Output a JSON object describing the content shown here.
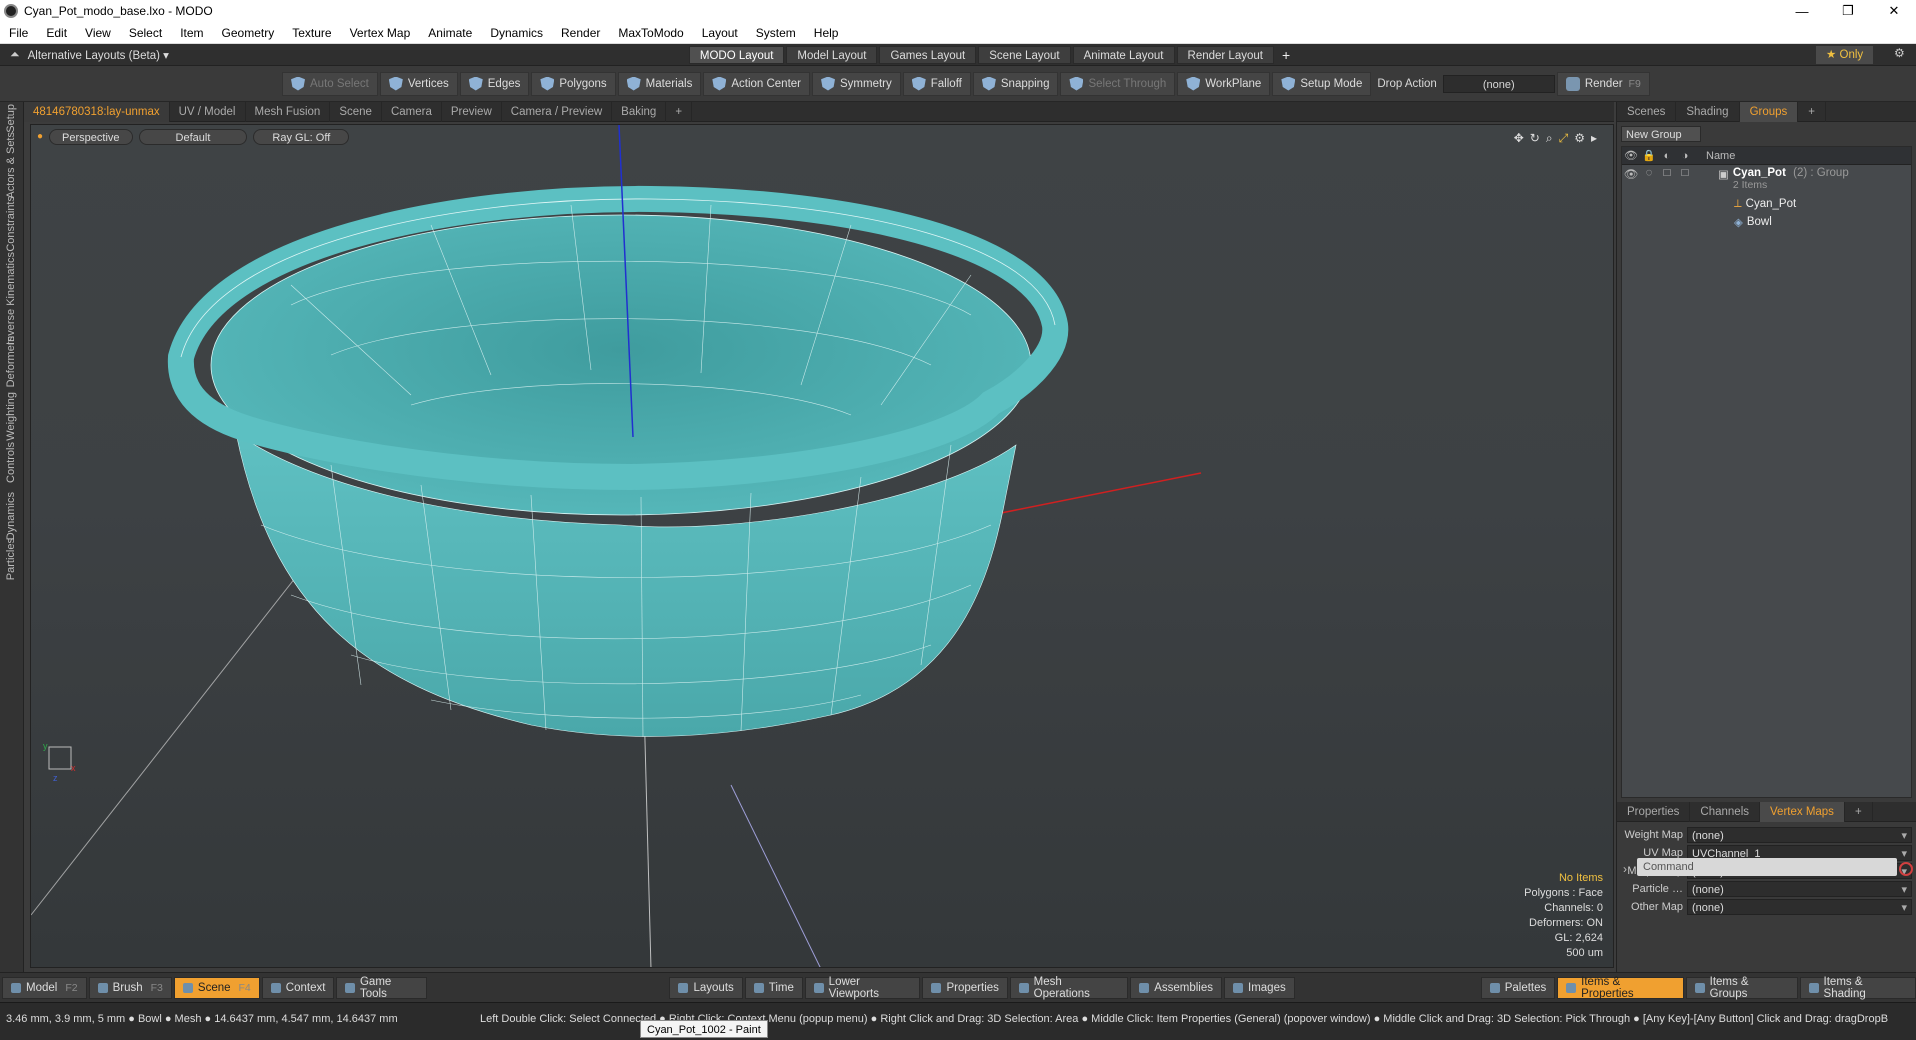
{
  "window": {
    "title": "Cyan_Pot_modo_base.lxo - MODO",
    "controls": [
      "—",
      "❐",
      "✕"
    ]
  },
  "menu": [
    "File",
    "Edit",
    "View",
    "Select",
    "Item",
    "Geometry",
    "Texture",
    "Vertex Map",
    "Animate",
    "Dynamics",
    "Render",
    "MaxToModo",
    "Layout",
    "System",
    "Help"
  ],
  "layoutbar": {
    "alt_layout": "Alternative Layouts (Beta) ▾",
    "tabs": [
      "MODO Layout",
      "Model Layout",
      "Games Layout",
      "Scene Layout",
      "Animate Layout",
      "Render Layout"
    ],
    "active_tab": "MODO Layout",
    "add": "+",
    "only": "★ Only"
  },
  "toolbar": {
    "items": [
      {
        "label": "Auto Select",
        "dim": true
      },
      {
        "label": "Vertices"
      },
      {
        "label": "Edges"
      },
      {
        "label": "Polygons"
      },
      {
        "label": "Materials"
      },
      {
        "label": "Action Center"
      },
      {
        "label": "Symmetry"
      },
      {
        "label": "Falloff"
      },
      {
        "label": "Snapping"
      },
      {
        "label": "Select Through",
        "dim": true
      },
      {
        "label": "WorkPlane"
      },
      {
        "label": "Setup Mode"
      }
    ],
    "drop_action_label": "Drop Action",
    "drop_action_value": "(none)",
    "render_label": "Render",
    "render_key": "F9"
  },
  "left_strip": [
    "Setup",
    "Actors & Sets",
    "Constraints",
    "Inverse Kinematics",
    "Deformers",
    "Weighting",
    "Controls",
    "Dynamics",
    "Particles"
  ],
  "viewport_tabs": [
    "48146780318:lay-unmax",
    "UV / Model",
    "Mesh Fusion",
    "Scene",
    "Camera",
    "Preview",
    "Camera / Preview",
    "Baking",
    "+"
  ],
  "viewport": {
    "view": "Perspective",
    "style": "Default",
    "raygl": "Ray GL: Off",
    "stats": {
      "items": "No Items",
      "polygons": "Polygons : Face",
      "channels": "Channels: 0",
      "deformers": "Deformers: ON",
      "gl": "GL: 2,624",
      "scale": "500 um"
    },
    "mesh_color": "#4fb0b2"
  },
  "right_panel": {
    "tabs": [
      "Scenes",
      "Shading",
      "Groups",
      "+"
    ],
    "active_tab": "Groups",
    "new_group": "New Group",
    "header_name": "Name",
    "tree": [
      {
        "label": "Cyan_Pot",
        "suffix": "(2) : Group",
        "sub": "2 Items"
      },
      {
        "label": "Cyan_Pot"
      },
      {
        "label": "Bowl"
      }
    ],
    "bottom_tabs": [
      "Properties",
      "Channels",
      "Vertex Maps",
      "+"
    ],
    "bottom_active": "Vertex Maps",
    "vmaps": [
      {
        "label": "Weight Map",
        "value": "(none)"
      },
      {
        "label": "UV Map",
        "value": "UVChannel_1"
      },
      {
        "label": "Morph Map",
        "value": "(none)"
      },
      {
        "label": "Particle …",
        "value": "(none)"
      },
      {
        "label": "Other Map",
        "value": "(none)"
      }
    ],
    "command_placeholder": "Command"
  },
  "bottombar": {
    "left": [
      {
        "label": "Model",
        "key": "F2"
      },
      {
        "label": "Brush",
        "key": "F3"
      },
      {
        "label": "Scene",
        "key": "F4",
        "active": true
      },
      {
        "label": "Context"
      },
      {
        "label": "Game Tools"
      }
    ],
    "center": [
      "Layouts",
      "Time",
      "Lower Viewports",
      "Properties",
      "Mesh Operations",
      "Assemblies",
      "Images"
    ],
    "right": [
      {
        "label": "Palettes"
      },
      {
        "label": "Items & Properties",
        "active": true
      },
      {
        "label": "Items & Groups"
      },
      {
        "label": "Items & Shading"
      }
    ]
  },
  "status": {
    "left": "3.46 mm, 3.9 mm, 5 mm ● Bowl ● Mesh ● 14.6437 mm, 4.547 mm, 14.6437 mm",
    "help": "Left Double Click: Select Connected ● Right Click: Context Menu (popup menu) ● Right Click and Drag: 3D Selection: Area ● Middle Click: Item Properties (General) (popover window) ● Middle Click and Drag: 3D Selection: Pick Through ● [Any Key]-[Any Button] Click and Drag: dragDropB",
    "tooltip": "Cyan_Pot_1002 - Paint"
  }
}
